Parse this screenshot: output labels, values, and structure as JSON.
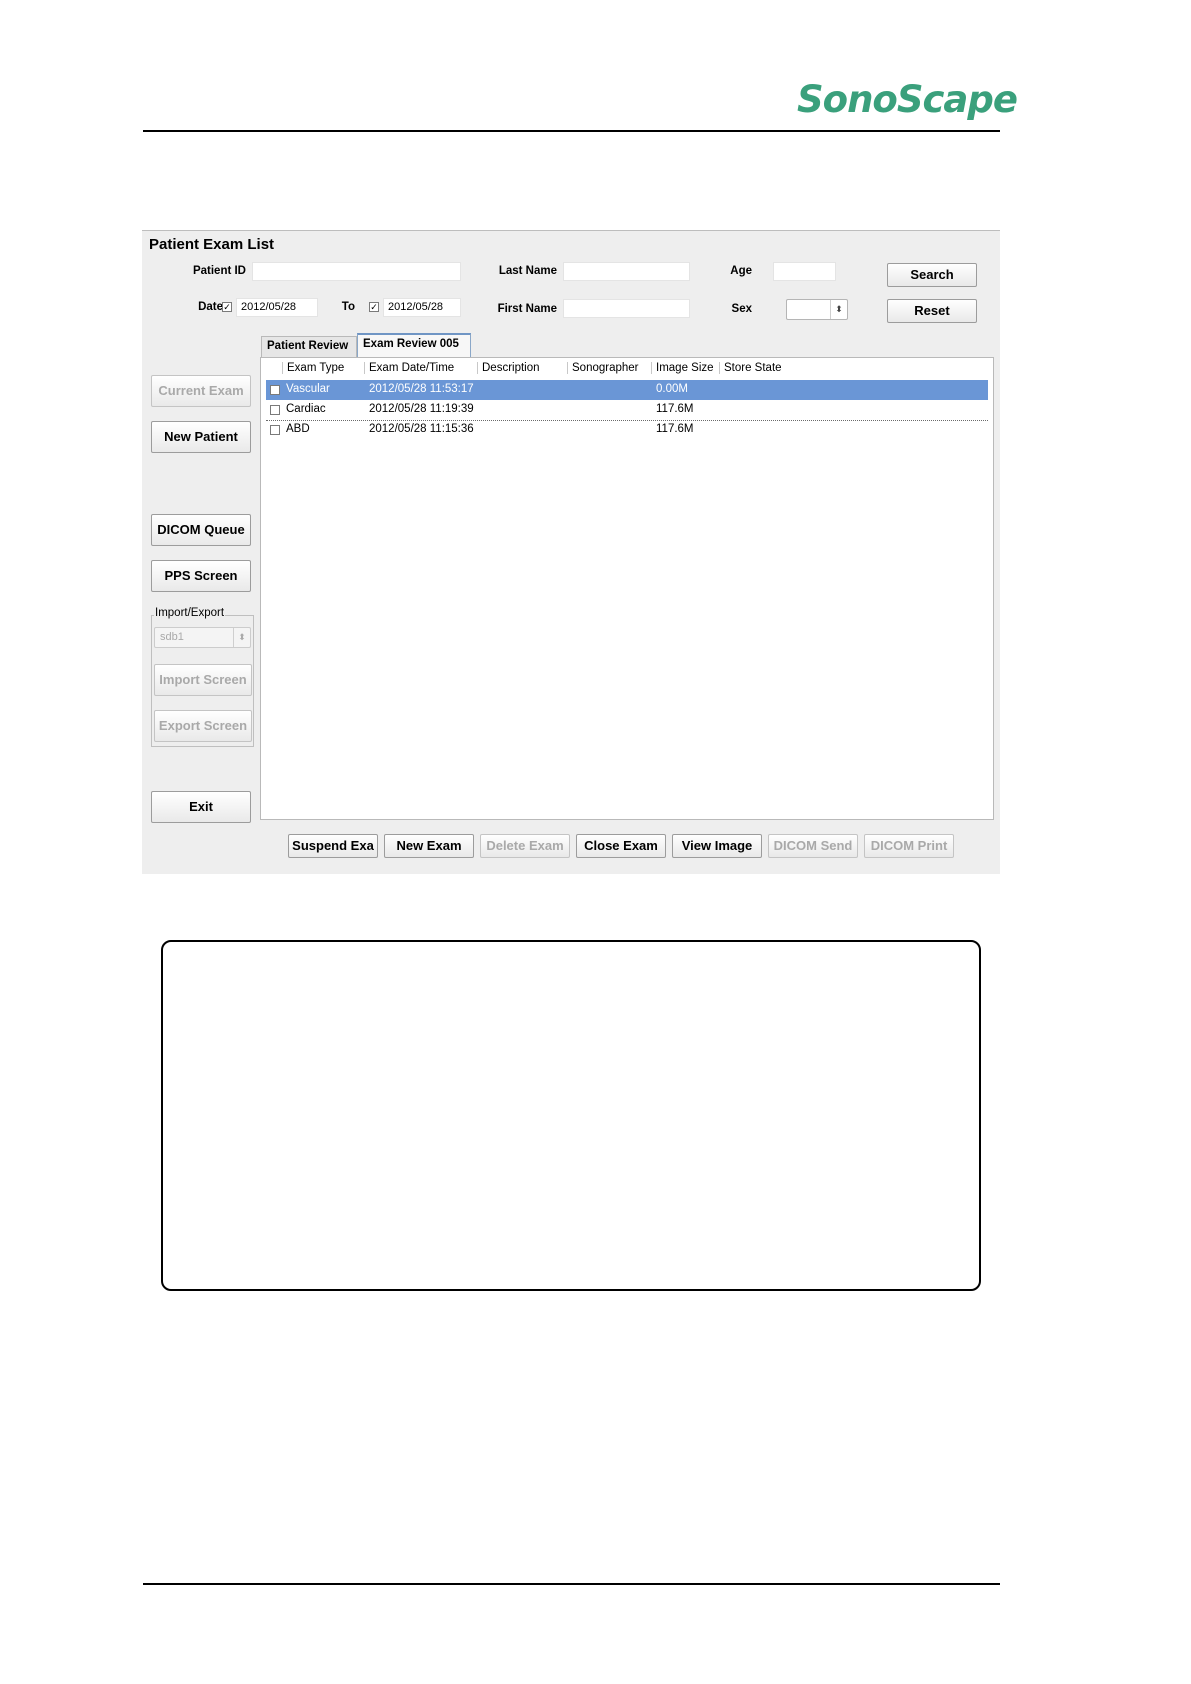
{
  "brand": {
    "logo_text": "SonoScape",
    "logo_color": "#3aa07c"
  },
  "window": {
    "title": "Patient Exam List",
    "search_form": {
      "patient_id_label": "Patient ID",
      "patient_id_value": "",
      "last_name_label": "Last Name",
      "last_name_value": "",
      "age_label": "Age",
      "age_value": "",
      "date_label": "Date",
      "date_checked": true,
      "date_from": "2012/05/28",
      "to_label": "To",
      "to_checked": true,
      "date_to": "2012/05/28",
      "first_name_label": "First Name",
      "first_name_value": "",
      "sex_label": "Sex",
      "sex_value": "",
      "search_label": "Search",
      "reset_label": "Reset"
    },
    "sidebar": {
      "current_exam": "Current Exam",
      "new_patient": "New Patient",
      "dicom_queue": "DICOM Queue",
      "pps_screen": "PPS Screen",
      "import_export_title": "Import/Export",
      "device_value": "sdb1",
      "import_screen": "Import Screen",
      "export_screen": "Export Screen",
      "exit": "Exit"
    },
    "tabs": [
      {
        "label": "Patient Review",
        "active": false
      },
      {
        "label": "Exam Review 005",
        "active": true
      }
    ],
    "table": {
      "columns": [
        "Exam Type",
        "Exam Date/Time",
        "Description",
        "Sonographer",
        "Image Size",
        "Store State"
      ],
      "rows": [
        {
          "exam_type": "Vascular",
          "datetime": "2012/05/28 11:53:17",
          "description": "",
          "sonographer": "",
          "size": "0.00M",
          "store_state": "",
          "selected": true
        },
        {
          "exam_type": "Cardiac",
          "datetime": "2012/05/28 11:19:39",
          "description": "",
          "sonographer": "",
          "size": "117.6M",
          "store_state": "",
          "selected": false
        },
        {
          "exam_type": "ABD",
          "datetime": "2012/05/28 11:15:36",
          "description": "",
          "sonographer": "",
          "size": "117.6M",
          "store_state": "",
          "selected": false
        }
      ],
      "selection_color": "#6a96d6"
    },
    "bottom_buttons": {
      "suspend_exam": "Suspend Exa",
      "new_exam": "New Exam",
      "delete_exam": "Delete Exam",
      "close_exam": "Close Exam",
      "view_image": "View Image",
      "dicom_send": "DICOM Send",
      "dicom_print": "DICOM Print"
    }
  }
}
